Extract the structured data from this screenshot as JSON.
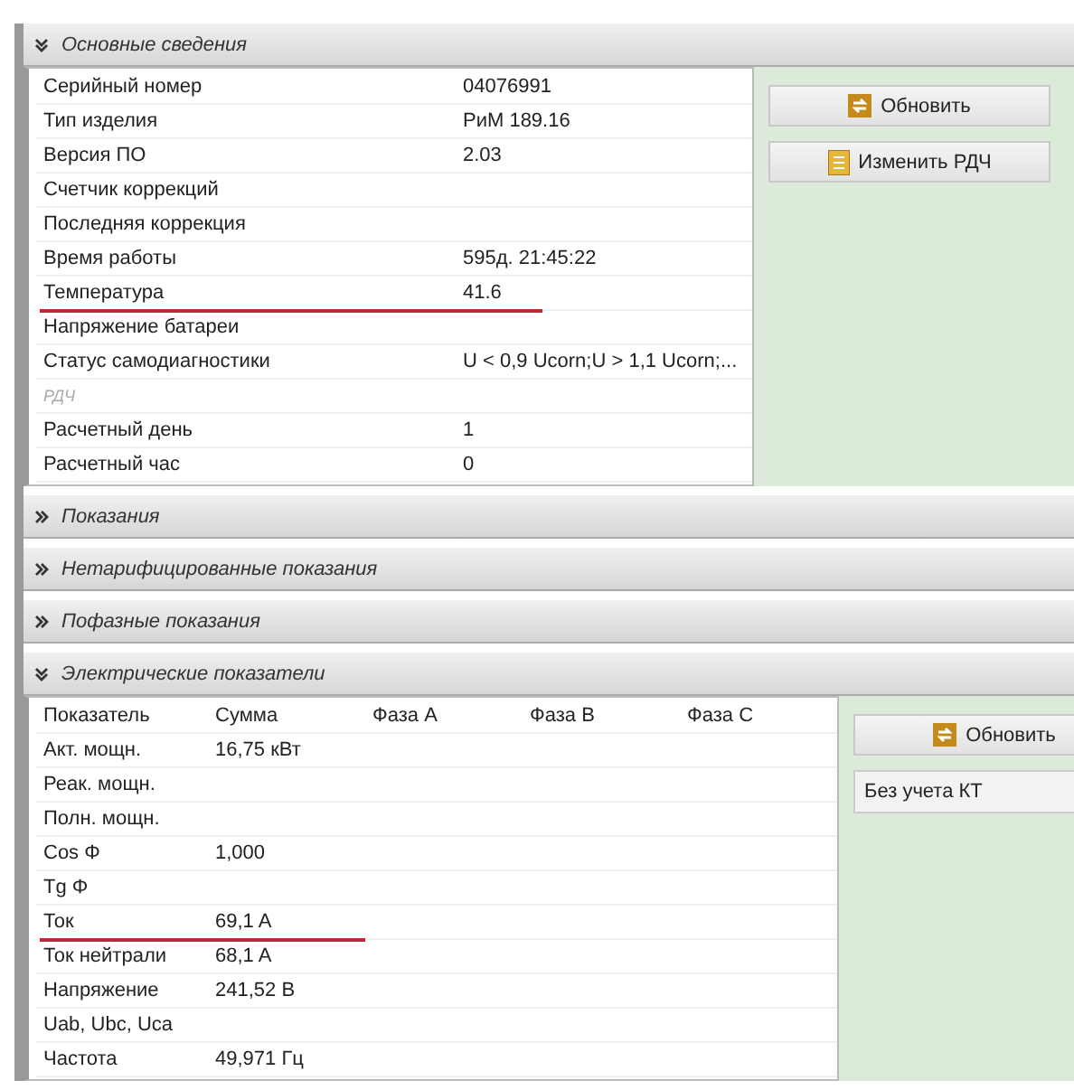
{
  "sections": [
    {
      "kind": "info",
      "title": "Основные сведения",
      "expanded": true,
      "rows": [
        {
          "label": "Серийный номер",
          "value": "04076991",
          "muted": false,
          "underlined": false
        },
        {
          "label": "Тип изделия",
          "value": "РиМ 189.16",
          "muted": false,
          "underlined": false
        },
        {
          "label": "Версия ПО",
          "value": "2.03",
          "muted": false,
          "underlined": false
        },
        {
          "label": "Счетчик коррекций",
          "muted": false,
          "underlined": false
        },
        {
          "label": "Последняя коррекция",
          "muted": false,
          "underlined": false
        },
        {
          "label": "Время работы",
          "value": "595д. 21:45:22",
          "muted": false,
          "underlined": false
        },
        {
          "label": "Температура",
          "value": "41.6",
          "muted": false,
          "underlined": true
        },
        {
          "label": "Напряжение батареи",
          "muted": false,
          "underlined": false
        },
        {
          "label": "Статус самодиагностики",
          "value": "U < 0,9 Ucorn;U > 1,1 Ucorn;...",
          "muted": false,
          "underlined": false
        },
        {
          "label": "РДЧ",
          "muted": true,
          "underlined": false
        },
        {
          "label": "Расчетный день",
          "value": "1",
          "muted": false,
          "underlined": false
        },
        {
          "label": "Расчетный час",
          "value": "0",
          "muted": false,
          "underlined": false
        }
      ],
      "buttons": [
        {
          "kind": "refresh",
          "label": "Обновить"
        },
        {
          "kind": "edit",
          "label": "Изменить РДЧ"
        }
      ]
    },
    {
      "title": "Показания",
      "expanded": false
    },
    {
      "title": "Нетарифицированные показания",
      "expanded": false
    },
    {
      "title": "Пофазные показания",
      "expanded": false
    },
    {
      "kind": "grid",
      "title": "Электрические показатели",
      "expanded": true,
      "columns": [
        "Показатель",
        "Сумма",
        "Фаза A",
        "Фаза B",
        "Фаза C"
      ],
      "rows": [
        {
          "cells": [
            "Акт. мощн.",
            "16,75 кВт"
          ],
          "underlined": false
        },
        {
          "cells": [
            "Реак. мощн."
          ],
          "underlined": false
        },
        {
          "cells": [
            "Полн. мощн."
          ],
          "underlined": false
        },
        {
          "cells": [
            "Cos Φ",
            "1,000"
          ],
          "underlined": false
        },
        {
          "cells": [
            "Tg Φ"
          ],
          "underlined": false
        },
        {
          "cells": [
            "Ток",
            "69,1 A"
          ],
          "underlined": true
        },
        {
          "cells": [
            "Ток нейтрали",
            "68,1 A"
          ],
          "underlined": false
        },
        {
          "cells": [
            "Напряжение",
            "241,52 В"
          ],
          "underlined": false
        },
        {
          "cells": [
            "Uab, Ubc, Uca"
          ],
          "underlined": false
        },
        {
          "cells": [
            "Частота",
            "49,971 Гц"
          ],
          "underlined": false
        }
      ],
      "buttons": [
        {
          "kind": "refresh",
          "label": "Обновить"
        }
      ],
      "select": {
        "value": "Без  учета КТ"
      }
    }
  ]
}
